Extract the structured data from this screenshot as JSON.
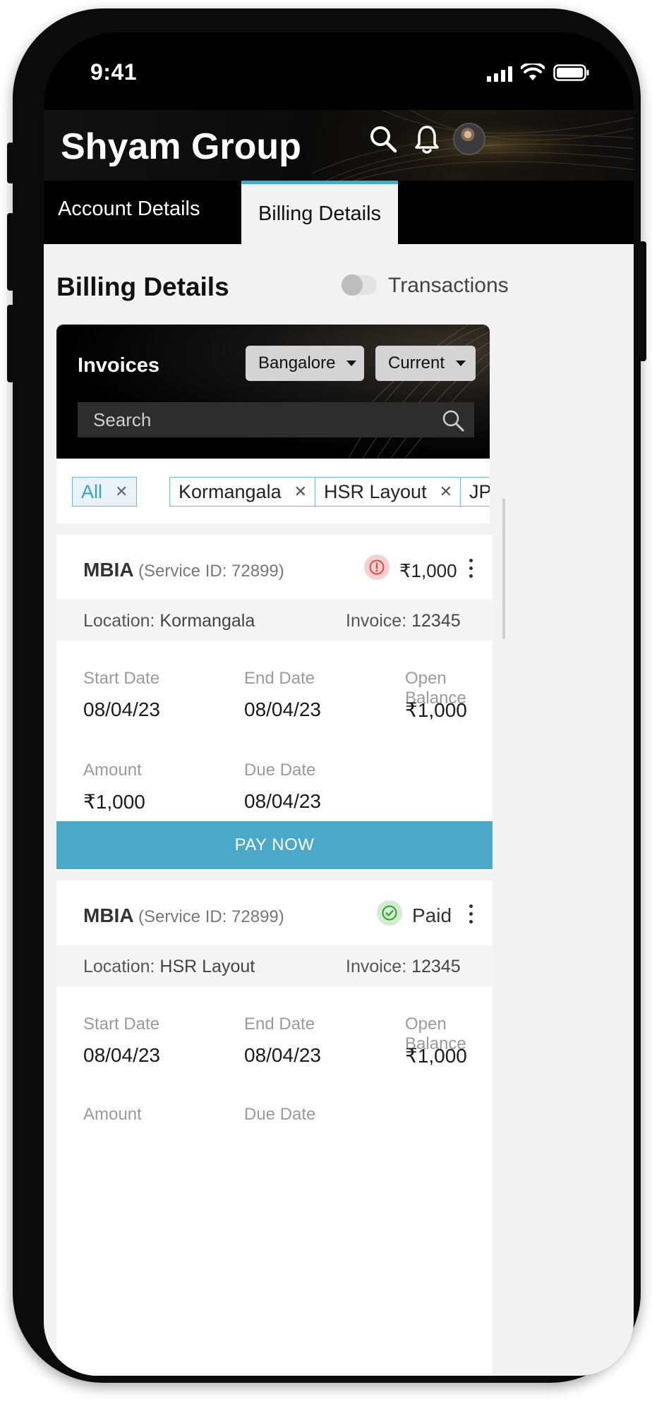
{
  "status_bar": {
    "time": "9:41"
  },
  "header": {
    "title": "Shyam Group"
  },
  "tabs": [
    {
      "label": "Account Details",
      "active": false
    },
    {
      "label": "Billing Details",
      "active": true
    }
  ],
  "page": {
    "title": "Billing Details",
    "toggle_label": "Transactions",
    "toggle_on": false
  },
  "invoices": {
    "label": "Invoices",
    "location_dropdown": "Bangalore",
    "period_dropdown": "Current",
    "search_placeholder": "Search"
  },
  "filter_chips": [
    {
      "label": "All",
      "active": true
    },
    {
      "label": "Kormangala",
      "active": false
    },
    {
      "label": "HSR Layout",
      "active": false
    },
    {
      "label": "JP Na",
      "active": false
    }
  ],
  "bills": [
    {
      "name": "MBIA",
      "service": "(Service ID: 72899)",
      "status": "overdue",
      "status_text": "₹1,000",
      "location_label": "Location:",
      "location": "Kormangala",
      "invoice_label": "Invoice:",
      "invoice": "12345",
      "start_date_label": "Start Date",
      "start_date": "08/04/23",
      "end_date_label": "End Date",
      "end_date": "08/04/23",
      "open_balance_label": "Open Balance",
      "open_balance": "₹1,000",
      "amount_label": "Amount",
      "amount": "₹1,000",
      "due_date_label": "Due Date",
      "due_date": "08/04/23",
      "action": "PAY NOW"
    },
    {
      "name": "MBIA",
      "service": "(Service ID: 72899)",
      "status": "paid",
      "status_text": "Paid",
      "location_label": "Location:",
      "location": "HSR Layout",
      "invoice_label": "Invoice:",
      "invoice": "12345",
      "start_date_label": "Start Date",
      "start_date": "08/04/23",
      "end_date_label": "End Date",
      "end_date": "08/04/23",
      "open_balance_label": "Open Balance",
      "open_balance": "₹1,000",
      "amount_label": "Amount",
      "due_date_label": "Due Date"
    }
  ],
  "colors": {
    "accent": "#4aa8c8",
    "alert_bg": "#f5d2d2",
    "alert_icon": "#e05252",
    "paid_bg": "#d4edd2",
    "paid_icon": "#3aa63a"
  }
}
